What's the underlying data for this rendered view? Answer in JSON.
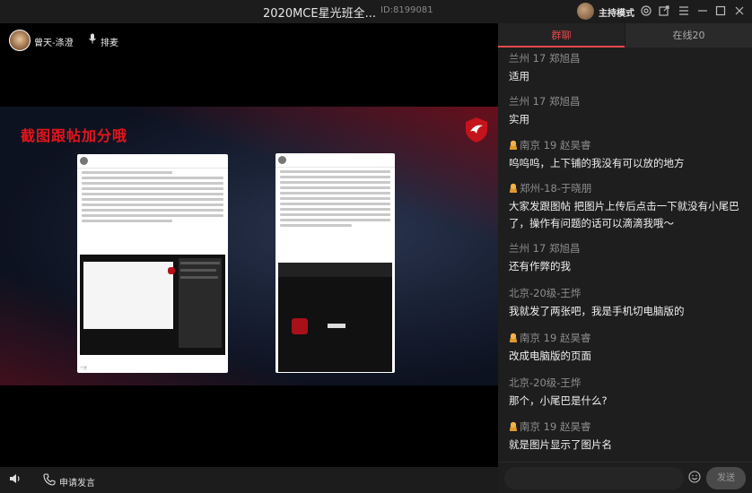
{
  "window": {
    "title": "2020MCE星光班全...",
    "room_id": "ID:8199081",
    "host_mode": "主持模式",
    "icons": [
      "settings-icon",
      "share-icon",
      "menu-icon",
      "minimize-icon",
      "maximize-icon",
      "close-icon"
    ]
  },
  "presenter": {
    "name": "曾天-涤澄",
    "mic_label": "排麦"
  },
  "slide": {
    "title": "截图跟帖加分哦",
    "card1": {
      "foot": "个赞"
    },
    "card2": {}
  },
  "bottom": {
    "apply_label": "申请发言"
  },
  "chat": {
    "tabs": [
      {
        "label": "群聊",
        "active": true
      },
      {
        "label": "在线20",
        "active": false
      }
    ],
    "messages": [
      {
        "author": "兰州  17  郑旭昌",
        "badge": false,
        "text": "适用"
      },
      {
        "author": "兰州  17  郑旭昌",
        "badge": false,
        "text": "实用"
      },
      {
        "author": "南京 19 赵昊睿",
        "badge": true,
        "text": "呜呜呜，上下铺的我没有可以放的地方"
      },
      {
        "author": "郑州-18-于晓朋",
        "badge": true,
        "text": "大家发跟图帖 把图片上传后点击一下就没有小尾巴了，操作有问题的话可以滴滴我哦～"
      },
      {
        "author": "兰州  17  郑旭昌",
        "badge": false,
        "text": "还有作弊的我"
      },
      {
        "author": "北京-20级-王烨",
        "badge": false,
        "text": "我就发了两张吧，我是手机切电脑版的"
      },
      {
        "author": "南京 19 赵昊睿",
        "badge": true,
        "text": "改成电脑版的页面"
      },
      {
        "author": "北京-20级-王烨",
        "badge": false,
        "text": "那个，小尾巴是什么?"
      },
      {
        "author": "南京 19 赵昊睿",
        "badge": true,
        "text": "就是图片显示了图片名"
      }
    ],
    "send_label": "发送"
  }
}
